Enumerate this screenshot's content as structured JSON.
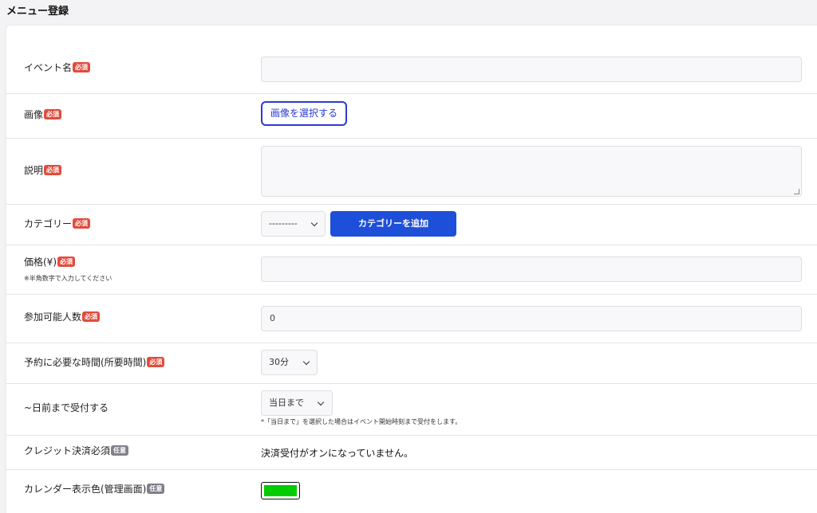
{
  "page": {
    "title": "メニュー登録"
  },
  "badges": {
    "required": "必須",
    "optional": "任意"
  },
  "fields": {
    "event_name": {
      "label": "イベント名",
      "value": ""
    },
    "image": {
      "label": "画像",
      "button": "画像を選択する"
    },
    "description": {
      "label": "説明",
      "value": ""
    },
    "category": {
      "label": "カテゴリー",
      "selected": "---------",
      "add_button": "カテゴリーを追加"
    },
    "price": {
      "label": "価格(¥)",
      "note": "※半角数字で入力してください",
      "value": ""
    },
    "capacity": {
      "label": "参加可能人数",
      "value": "0"
    },
    "duration": {
      "label": "予約に必要な時間(所要時間)",
      "selected": "30分"
    },
    "deadline": {
      "label": "~日前まで受付する",
      "selected": "当日まで",
      "note": "*「当日まで」を選択した場合はイベント開始時刻まで受付をします。"
    },
    "credit": {
      "label": "クレジット決済必須",
      "status": "決済受付がオンになっていません。"
    },
    "calendar_color": {
      "label": "カレンダー表示色(管理画面)",
      "color": "#00cc00"
    }
  },
  "colors": {
    "accent": "#1e4fd8",
    "outline_accent": "#2a3bd1",
    "required_badge": "#e24b3b",
    "optional_badge": "#7f8089"
  }
}
